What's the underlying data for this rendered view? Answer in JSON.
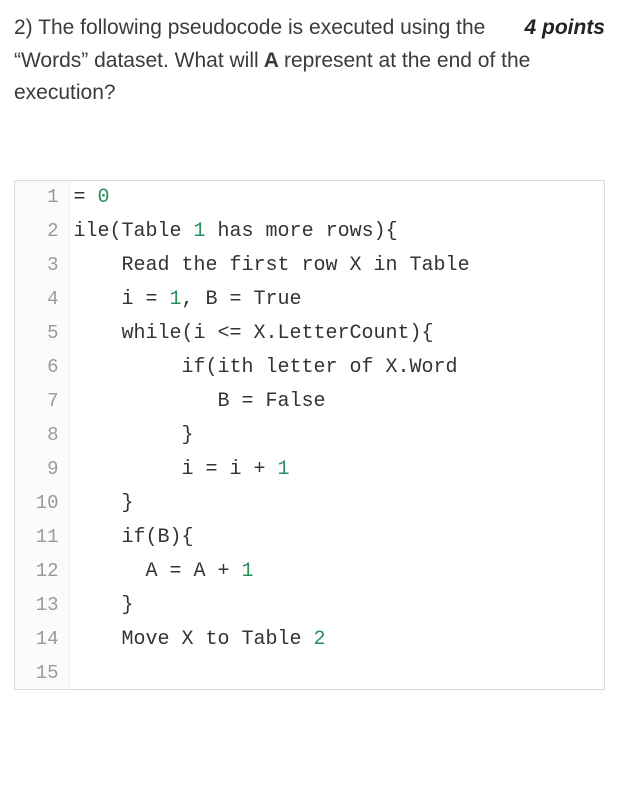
{
  "question": {
    "number": "2)",
    "points_label": "4 points",
    "text_a": "The following pseudocode is",
    "text_b": "executed using the “Words” dataset. What will",
    "bold_var": " A ",
    "text_c": "represent at the end of the execution?"
  },
  "code": {
    "lines": [
      {
        "n": "1",
        "tokens": [
          {
            "t": "= ",
            "c": "tok-op"
          },
          {
            "t": "0",
            "c": "tok-green"
          }
        ]
      },
      {
        "n": "2",
        "tokens": [
          {
            "t": "ile(Table ",
            "c": "tok-id"
          },
          {
            "t": "1",
            "c": "tok-green"
          },
          {
            "t": " has more rows){",
            "c": "tok-id"
          }
        ]
      },
      {
        "n": "3",
        "tokens": [
          {
            "t": "    Read the first row X in Table ",
            "c": "tok-id"
          }
        ]
      },
      {
        "n": "4",
        "tokens": [
          {
            "t": "    i = ",
            "c": "tok-id"
          },
          {
            "t": "1",
            "c": "tok-green"
          },
          {
            "t": ", B = True",
            "c": "tok-id"
          }
        ]
      },
      {
        "n": "5",
        "tokens": [
          {
            "t": "    while(i <= X.LetterCount){",
            "c": "tok-id"
          }
        ]
      },
      {
        "n": "6",
        "tokens": [
          {
            "t": "         if(ith letter of X.Word ",
            "c": "tok-id"
          }
        ]
      },
      {
        "n": "7",
        "tokens": [
          {
            "t": "            B = False",
            "c": "tok-id"
          }
        ]
      },
      {
        "n": "8",
        "tokens": [
          {
            "t": "         }",
            "c": "tok-id"
          }
        ]
      },
      {
        "n": "9",
        "tokens": [
          {
            "t": "         i = i + ",
            "c": "tok-id"
          },
          {
            "t": "1",
            "c": "tok-green"
          }
        ]
      },
      {
        "n": "10",
        "tokens": [
          {
            "t": "    }",
            "c": "tok-id"
          }
        ]
      },
      {
        "n": "11",
        "tokens": [
          {
            "t": "    if(B){",
            "c": "tok-id"
          }
        ]
      },
      {
        "n": "12",
        "tokens": [
          {
            "t": "      A = A + ",
            "c": "tok-id"
          },
          {
            "t": "1",
            "c": "tok-green"
          }
        ]
      },
      {
        "n": "13",
        "tokens": [
          {
            "t": "    }",
            "c": "tok-id"
          }
        ]
      },
      {
        "n": "14",
        "tokens": [
          {
            "t": "    Move X to Table ",
            "c": "tok-id"
          },
          {
            "t": "2",
            "c": "tok-green"
          }
        ]
      },
      {
        "n": "15",
        "tokens": [
          {
            "t": "",
            "c": "tok-id"
          }
        ]
      }
    ]
  }
}
